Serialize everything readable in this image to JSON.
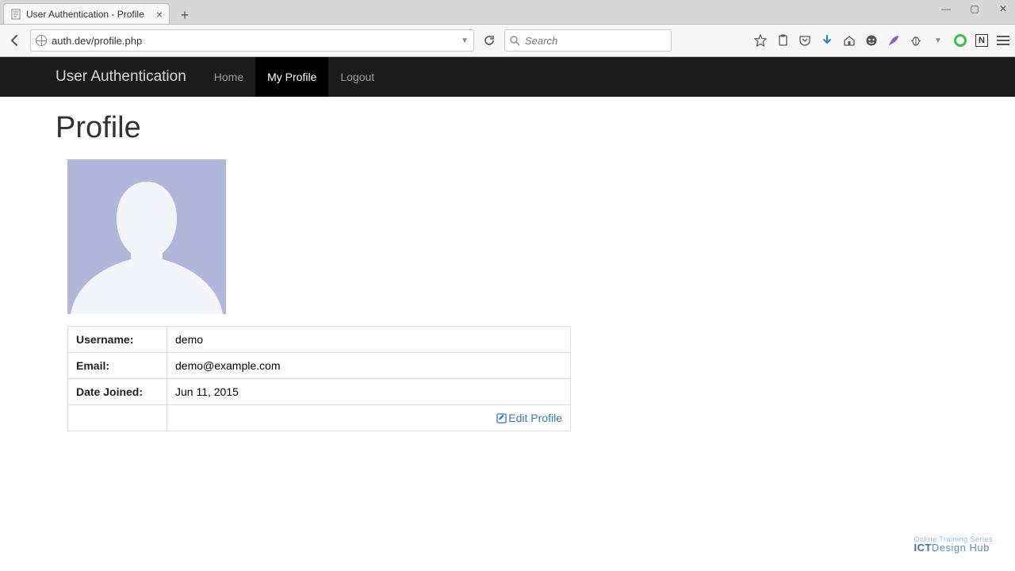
{
  "browser": {
    "tab_title": "User Authentication - Profile",
    "url": "auth.dev/profile.php",
    "search_placeholder": "Search"
  },
  "navbar": {
    "brand": "User Authentication",
    "items": [
      {
        "label": "Home",
        "active": false
      },
      {
        "label": "My Profile",
        "active": true
      },
      {
        "label": "Logout",
        "active": false
      }
    ]
  },
  "page": {
    "heading": "Profile",
    "fields": {
      "username_label": "Username:",
      "username_value": "demo",
      "email_label": "Email:",
      "email_value": "demo@example.com",
      "date_joined_label": "Date Joined:",
      "date_joined_value": "Jun 11, 2015"
    },
    "edit_link": "Edit Profile"
  },
  "watermark": {
    "small": "Online Training Series",
    "main_1": "ICT",
    "main_2": "Design Hub"
  }
}
